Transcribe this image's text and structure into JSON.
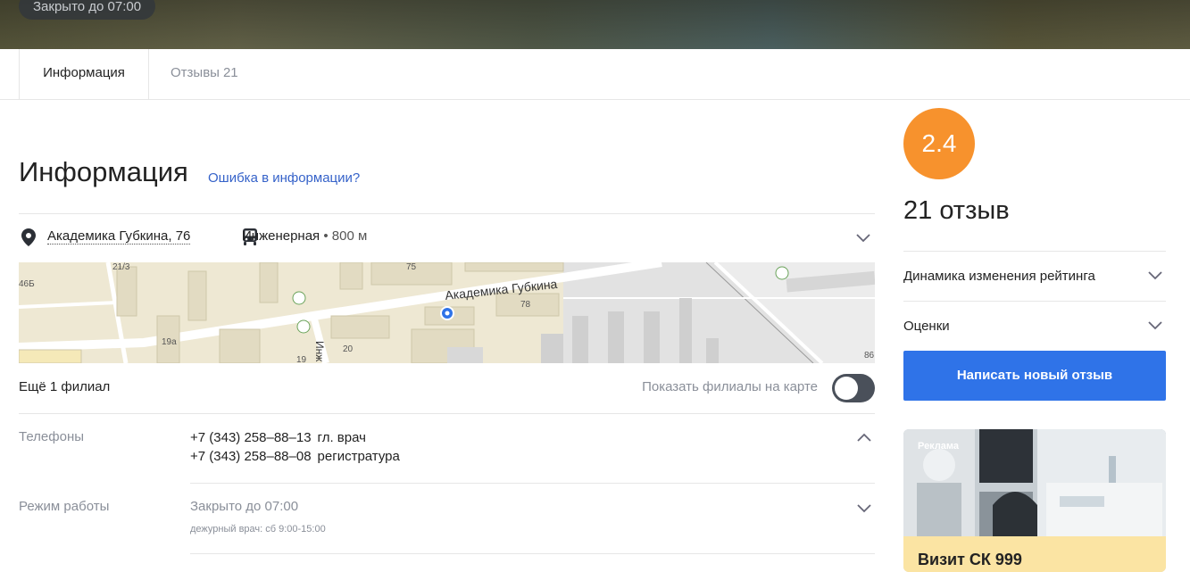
{
  "hero": {
    "status_badge": "Закрыто до 07:00"
  },
  "tabs": [
    {
      "label": "Информация",
      "count": ""
    },
    {
      "label": "Отзывы",
      "count": "21"
    }
  ],
  "info": {
    "heading": "Информация",
    "error_link": "Ошибка в информации?",
    "address": "Академика Губкина, 76",
    "metro_name": "Инженерная",
    "metro_distance": "• 800 м",
    "branches": "Ещё 1 филиал",
    "show_branches_label": "Показать филиалы на карте",
    "show_branches_on": false,
    "phones_label": "Телефоны",
    "phones": [
      {
        "number": "+7 (343) 258–88–13",
        "note": "гл. врач"
      },
      {
        "number": "+7 (343) 258–88–08",
        "note": "регистратура"
      }
    ],
    "hours_label": "Режим работы",
    "hours_status": "Закрыто до 07:00",
    "hours_note": "дежурный врач: сб 9:00-15:00"
  },
  "map": {
    "street_label": "Академика Губкина",
    "side_street_label": "Инж",
    "house_numbers": [
      "21/3",
      "46Б",
      "75",
      "78",
      "19а",
      "20",
      "19",
      "86"
    ],
    "marker_color": "#2f73e8"
  },
  "sidebar": {
    "rating": "2.4",
    "rating_color": "#f7922d",
    "reviews_count": "21 отзыв",
    "items": [
      {
        "label": "Динамика изменения рейтинга"
      },
      {
        "label": "Оценки"
      }
    ],
    "write_review": "Написать новый отзыв",
    "accent_color": "#2f73e8"
  },
  "ad": {
    "label": "Реклама",
    "title": "Визит СК 999"
  }
}
